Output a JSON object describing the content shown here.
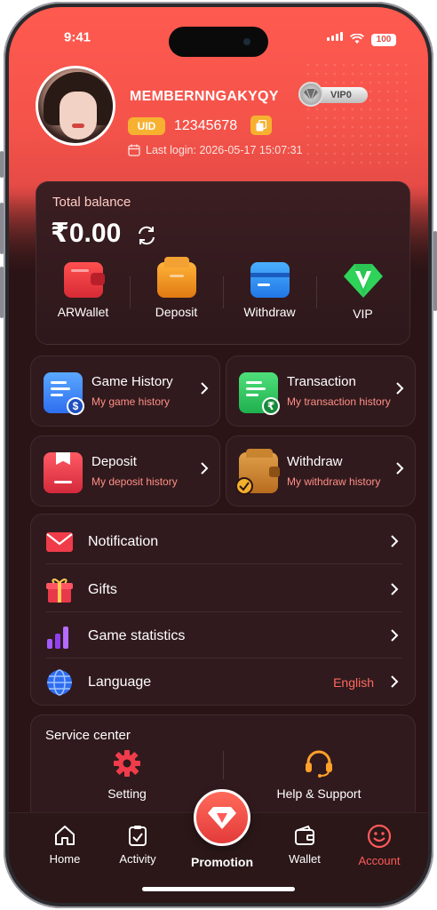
{
  "status": {
    "time": "9:41",
    "battery": "100"
  },
  "profile": {
    "username": "MEMBERNNGAKYQY",
    "vip_label": "VIP0",
    "uid_tag": "UID",
    "uid": "12345678",
    "last_login": "Last login: 2026-05-17 15:07:31"
  },
  "balance": {
    "label": "Total balance",
    "amount": "₹0.00",
    "actions": [
      {
        "label": "ARWallet",
        "icon": "wallet-icon"
      },
      {
        "label": "Deposit",
        "icon": "deposit-icon"
      },
      {
        "label": "Withdraw",
        "icon": "card-icon"
      },
      {
        "label": "VIP",
        "icon": "vip-icon"
      }
    ]
  },
  "tiles": [
    {
      "title": "Game History",
      "sub": "My game history",
      "icon": "game-history-icon"
    },
    {
      "title": "Transaction",
      "sub": "My transaction history",
      "icon": "transaction-icon"
    },
    {
      "title": "Deposit",
      "sub": "My deposit history",
      "icon": "deposit-history-icon"
    },
    {
      "title": "Withdraw",
      "sub": "My withdraw history",
      "icon": "withdraw-history-icon"
    }
  ],
  "menu": [
    {
      "label": "Notification",
      "icon": "mail-icon"
    },
    {
      "label": "Gifts",
      "icon": "gift-icon"
    },
    {
      "label": "Game statistics",
      "icon": "bar-chart-icon"
    },
    {
      "label": "Language",
      "icon": "globe-icon",
      "value": "English"
    }
  ],
  "service": {
    "title": "Service center",
    "items": [
      {
        "label": "Setting",
        "icon": "gear-icon"
      },
      {
        "label": "Help & Support",
        "icon": "headset-icon"
      }
    ]
  },
  "tabs": [
    {
      "label": "Home"
    },
    {
      "label": "Activity"
    },
    {
      "label": "Promotion"
    },
    {
      "label": "Wallet"
    },
    {
      "label": "Account"
    }
  ],
  "colors": {
    "accent": "#ff5a50",
    "background": "#2b1416",
    "gold": "#f7b131",
    "subtext": "#ff8f86"
  }
}
